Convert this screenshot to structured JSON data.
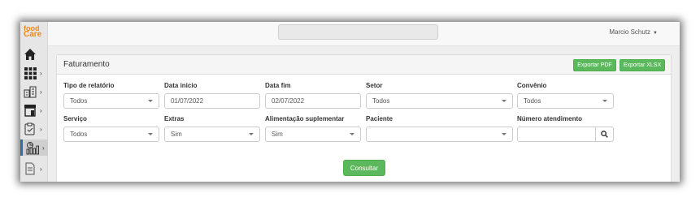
{
  "brand": {
    "logo_line1": "food",
    "logo_line2": "Care"
  },
  "header": {
    "user_name": "Marcio Schutz"
  },
  "sidebar": {
    "items": [
      {
        "name": "home-icon"
      },
      {
        "name": "grid-icon"
      },
      {
        "name": "building-icon"
      },
      {
        "name": "store-icon"
      },
      {
        "name": "clipboard-icon"
      },
      {
        "name": "report-chart-icon"
      },
      {
        "name": "document-icon"
      }
    ]
  },
  "panel": {
    "title": "Faturamento",
    "export_pdf": "Exportar PDF",
    "export_xlsx": "Exportar XLSX"
  },
  "form": {
    "tipo_relatorio": {
      "label": "Tipo de relatório",
      "value": "Todos"
    },
    "data_inicio": {
      "label": "Data inicio",
      "value": "01/07/2022"
    },
    "data_fim": {
      "label": "Data fim",
      "value": "02/07/2022"
    },
    "setor": {
      "label": "Setor",
      "value": "Todos"
    },
    "convenio": {
      "label": "Convênio",
      "value": "Todos"
    },
    "servico": {
      "label": "Serviço",
      "value": "Todos"
    },
    "extras": {
      "label": "Extras",
      "value": "Sim"
    },
    "alimentacao": {
      "label": "Alimentação suplementar",
      "value": "Sim"
    },
    "paciente": {
      "label": "Paciente",
      "value": ""
    },
    "numero_atendimento": {
      "label": "Número atendimento",
      "value": ""
    },
    "submit": "Consultar"
  }
}
